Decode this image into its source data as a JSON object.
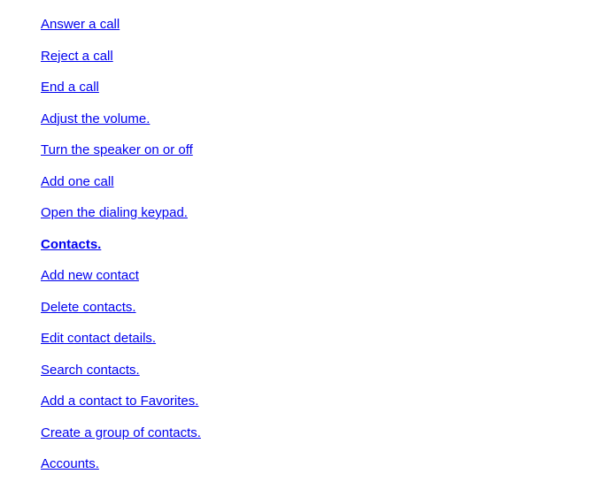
{
  "links": [
    {
      "label": "Answer a call",
      "bold": false
    },
    {
      "label": "Reject a call",
      "bold": false
    },
    {
      "label": "End a call",
      "bold": false
    },
    {
      "label": "Adjust the volume.  ",
      "bold": false
    },
    {
      "label": "Turn the speaker on or off",
      "bold": false
    },
    {
      "label": "Add one call",
      "bold": false
    },
    {
      "label": "Open the dialing keypad.  ",
      "bold": false
    },
    {
      "label": "Contacts.  ",
      "bold": true
    },
    {
      "label": "Add new contact",
      "bold": false
    },
    {
      "label": "Delete contacts.  ",
      "bold": false
    },
    {
      "label": "Edit contact details.  ",
      "bold": false
    },
    {
      "label": "Search contacts.  ",
      "bold": false
    },
    {
      "label": "Add a contact to Favorites.  ",
      "bold": false
    },
    {
      "label": "Create a group of contacts.  ",
      "bold": false
    },
    {
      "label": "Accounts.  ",
      "bold": false
    }
  ]
}
